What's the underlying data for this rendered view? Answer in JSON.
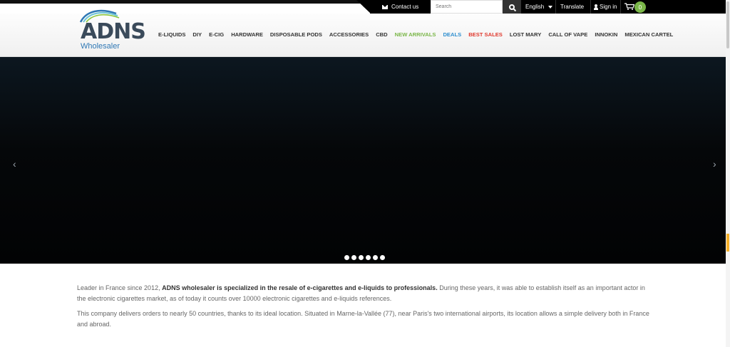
{
  "topbar": {
    "contact_label": "Contact us",
    "search_placeholder": "Search",
    "language": "English",
    "translate_label": "Translate",
    "signin_label": "Sign in",
    "cart_count": "0"
  },
  "brand": {
    "name": "ADNS",
    "subtitle": "Wholesaler"
  },
  "nav": [
    {
      "label": "E-LIQUIDS",
      "color": "#333333"
    },
    {
      "label": "DIY",
      "color": "#333333"
    },
    {
      "label": "E-CIG",
      "color": "#333333"
    },
    {
      "label": "HARDWARE",
      "color": "#333333"
    },
    {
      "label": "DISPOSABLE PODS",
      "color": "#333333"
    },
    {
      "label": "ACCESSORIES",
      "color": "#333333"
    },
    {
      "label": "CBD",
      "color": "#333333"
    },
    {
      "label": "NEW ARRIVALS",
      "color": "#7ab648"
    },
    {
      "label": "DEALS",
      "color": "#2f8fd0"
    },
    {
      "label": "BEST SALES",
      "color": "#e03a2f"
    },
    {
      "label": "LOST MARY",
      "color": "#333333"
    },
    {
      "label": "CALL OF VAPE",
      "color": "#333333"
    },
    {
      "label": "INNOKIN",
      "color": "#333333"
    },
    {
      "label": "MEXICAN CARTEL",
      "color": "#333333"
    }
  ],
  "carousel": {
    "prev_glyph": "‹",
    "next_glyph": "›",
    "slide_count": 6,
    "active_index": 0
  },
  "intro": {
    "p1_before": "Leader in France since 2012, ",
    "p1_bold": "ADNS wholesaler is specialized in the resale of e-cigarettes and e-liquids to professionals.",
    "p1_after": " During these years, it was able to establish itself as an important actor in the electronic cigarettes market, as of today it counts over 10000 electronic cigarettes and e-liquids references.",
    "p2": "This company delivers orders to nearly 50 countries, thanks to its ideal location. Situated in Marne-la-Vallée (77), near Paris's two international airports, its location allows a simple delivery both in France and abroad."
  }
}
